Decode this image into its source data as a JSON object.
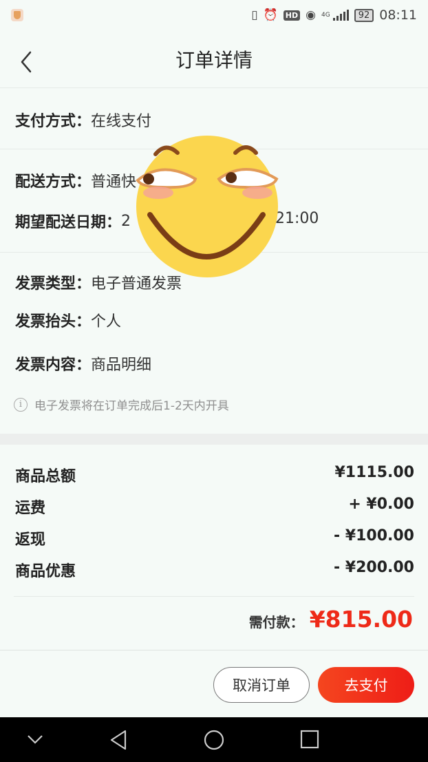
{
  "status_bar": {
    "battery": "92",
    "time": "08:11",
    "network": "4G"
  },
  "header": {
    "title": "订单详情"
  },
  "payment": {
    "label": "支付方式：",
    "value": "在线支付"
  },
  "delivery": {
    "method_label": "配送方式：",
    "method_value": "普通快",
    "date_label": "期望配送日期：",
    "date_value_start": "2",
    "date_value_end": "21:00"
  },
  "invoice": {
    "type_label": "发票类型：",
    "type_value": "电子普通发票",
    "title_label": "发票抬头：",
    "title_value": "个人",
    "content_label": "发票内容：",
    "content_value": "商品明细",
    "note": "电子发票将在订单完成后1-2天内开具",
    "note_icon": "info-icon"
  },
  "amounts": [
    {
      "label": "商品总额",
      "value": "¥1115.00"
    },
    {
      "label": "运费",
      "value": "+ ¥0.00"
    },
    {
      "label": "返现",
      "value": "- ¥100.00"
    },
    {
      "label": "商品优惠",
      "value": "- ¥200.00"
    }
  ],
  "total": {
    "label": "需付款：",
    "value": "¥815.00"
  },
  "actions": {
    "cancel_label": "取消订单",
    "pay_label": "去支付"
  },
  "colors": {
    "accent": "#ee2a18",
    "background": "#f5faf7",
    "sticker_face": "#fbd64e"
  }
}
